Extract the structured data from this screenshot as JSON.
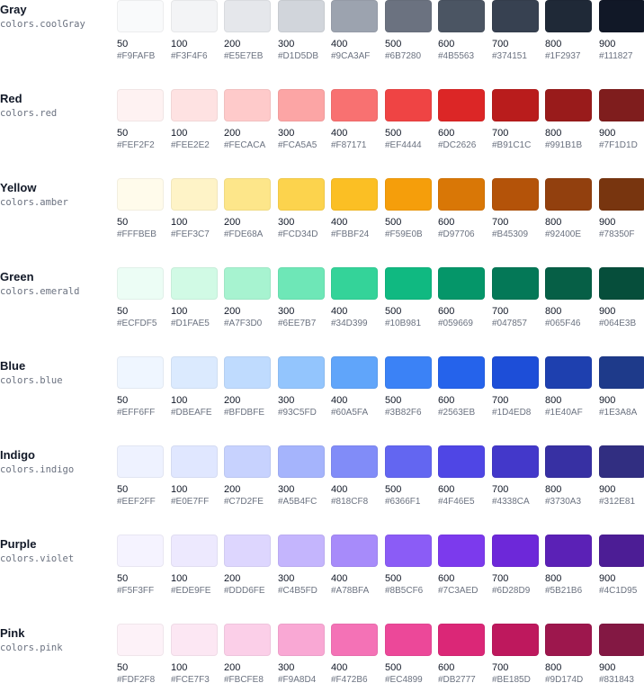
{
  "palettes": [
    {
      "name": "Gray",
      "var": "colors.coolGray",
      "swatches": [
        {
          "shade": "50",
          "hex": "#F9FAFB"
        },
        {
          "shade": "100",
          "hex": "#F3F4F6"
        },
        {
          "shade": "200",
          "hex": "#E5E7EB"
        },
        {
          "shade": "300",
          "hex": "#D1D5DB"
        },
        {
          "shade": "400",
          "hex": "#9CA3AF"
        },
        {
          "shade": "500",
          "hex": "#6B7280"
        },
        {
          "shade": "600",
          "hex": "#4B5563"
        },
        {
          "shade": "700",
          "hex": "#374151"
        },
        {
          "shade": "800",
          "hex": "#1F2937"
        },
        {
          "shade": "900",
          "hex": "#111827"
        }
      ]
    },
    {
      "name": "Red",
      "var": "colors.red",
      "swatches": [
        {
          "shade": "50",
          "hex": "#FEF2F2"
        },
        {
          "shade": "100",
          "hex": "#FEE2E2"
        },
        {
          "shade": "200",
          "hex": "#FECACA"
        },
        {
          "shade": "300",
          "hex": "#FCA5A5"
        },
        {
          "shade": "400",
          "hex": "#F87171"
        },
        {
          "shade": "500",
          "hex": "#EF4444"
        },
        {
          "shade": "600",
          "hex": "#DC2626"
        },
        {
          "shade": "700",
          "hex": "#B91C1C"
        },
        {
          "shade": "800",
          "hex": "#991B1B"
        },
        {
          "shade": "900",
          "hex": "#7F1D1D"
        }
      ]
    },
    {
      "name": "Yellow",
      "var": "colors.amber",
      "swatches": [
        {
          "shade": "50",
          "hex": "#FFFBEB"
        },
        {
          "shade": "100",
          "hex": "#FEF3C7"
        },
        {
          "shade": "200",
          "hex": "#FDE68A"
        },
        {
          "shade": "300",
          "hex": "#FCD34D"
        },
        {
          "shade": "400",
          "hex": "#FBBF24"
        },
        {
          "shade": "500",
          "hex": "#F59E0B"
        },
        {
          "shade": "600",
          "hex": "#D97706"
        },
        {
          "shade": "700",
          "hex": "#B45309"
        },
        {
          "shade": "800",
          "hex": "#92400E"
        },
        {
          "shade": "900",
          "hex": "#78350F"
        }
      ]
    },
    {
      "name": "Green",
      "var": "colors.emerald",
      "swatches": [
        {
          "shade": "50",
          "hex": "#ECFDF5"
        },
        {
          "shade": "100",
          "hex": "#D1FAE5"
        },
        {
          "shade": "200",
          "hex": "#A7F3D0"
        },
        {
          "shade": "300",
          "hex": "#6EE7B7"
        },
        {
          "shade": "400",
          "hex": "#34D399"
        },
        {
          "shade": "500",
          "hex": "#10B981"
        },
        {
          "shade": "600",
          "hex": "#059669"
        },
        {
          "shade": "700",
          "hex": "#047857"
        },
        {
          "shade": "800",
          "hex": "#065F46"
        },
        {
          "shade": "900",
          "hex": "#064E3B"
        }
      ]
    },
    {
      "name": "Blue",
      "var": "colors.blue",
      "swatches": [
        {
          "shade": "50",
          "hex": "#EFF6FF"
        },
        {
          "shade": "100",
          "hex": "#DBEAFE"
        },
        {
          "shade": "200",
          "hex": "#BFDBFE"
        },
        {
          "shade": "300",
          "hex": "#93C5FD"
        },
        {
          "shade": "400",
          "hex": "#60A5FA"
        },
        {
          "shade": "500",
          "hex": "#3B82F6"
        },
        {
          "shade": "600",
          "hex": "#2563EB"
        },
        {
          "shade": "700",
          "hex": "#1D4ED8"
        },
        {
          "shade": "800",
          "hex": "#1E40AF"
        },
        {
          "shade": "900",
          "hex": "#1E3A8A"
        }
      ]
    },
    {
      "name": "Indigo",
      "var": "colors.indigo",
      "swatches": [
        {
          "shade": "50",
          "hex": "#EEF2FF"
        },
        {
          "shade": "100",
          "hex": "#E0E7FF"
        },
        {
          "shade": "200",
          "hex": "#C7D2FE"
        },
        {
          "shade": "300",
          "hex": "#A5B4FC"
        },
        {
          "shade": "400",
          "hex": "#818CF8"
        },
        {
          "shade": "500",
          "hex": "#6366F1"
        },
        {
          "shade": "600",
          "hex": "#4F46E5"
        },
        {
          "shade": "700",
          "hex": "#4338CA"
        },
        {
          "shade": "800",
          "hex": "#3730A3"
        },
        {
          "shade": "900",
          "hex": "#312E81"
        }
      ]
    },
    {
      "name": "Purple",
      "var": "colors.violet",
      "swatches": [
        {
          "shade": "50",
          "hex": "#F5F3FF"
        },
        {
          "shade": "100",
          "hex": "#EDE9FE"
        },
        {
          "shade": "200",
          "hex": "#DDD6FE"
        },
        {
          "shade": "300",
          "hex": "#C4B5FD"
        },
        {
          "shade": "400",
          "hex": "#A78BFA"
        },
        {
          "shade": "500",
          "hex": "#8B5CF6"
        },
        {
          "shade": "600",
          "hex": "#7C3AED"
        },
        {
          "shade": "700",
          "hex": "#6D28D9"
        },
        {
          "shade": "800",
          "hex": "#5B21B6"
        },
        {
          "shade": "900",
          "hex": "#4C1D95"
        }
      ]
    },
    {
      "name": "Pink",
      "var": "colors.pink",
      "swatches": [
        {
          "shade": "50",
          "hex": "#FDF2F8"
        },
        {
          "shade": "100",
          "hex": "#FCE7F3"
        },
        {
          "shade": "200",
          "hex": "#FBCFE8"
        },
        {
          "shade": "300",
          "hex": "#F9A8D4"
        },
        {
          "shade": "400",
          "hex": "#F472B6"
        },
        {
          "shade": "500",
          "hex": "#EC4899"
        },
        {
          "shade": "600",
          "hex": "#DB2777"
        },
        {
          "shade": "700",
          "hex": "#BE185D"
        },
        {
          "shade": "800",
          "hex": "#9D174D"
        },
        {
          "shade": "900",
          "hex": "#831843"
        }
      ]
    }
  ]
}
